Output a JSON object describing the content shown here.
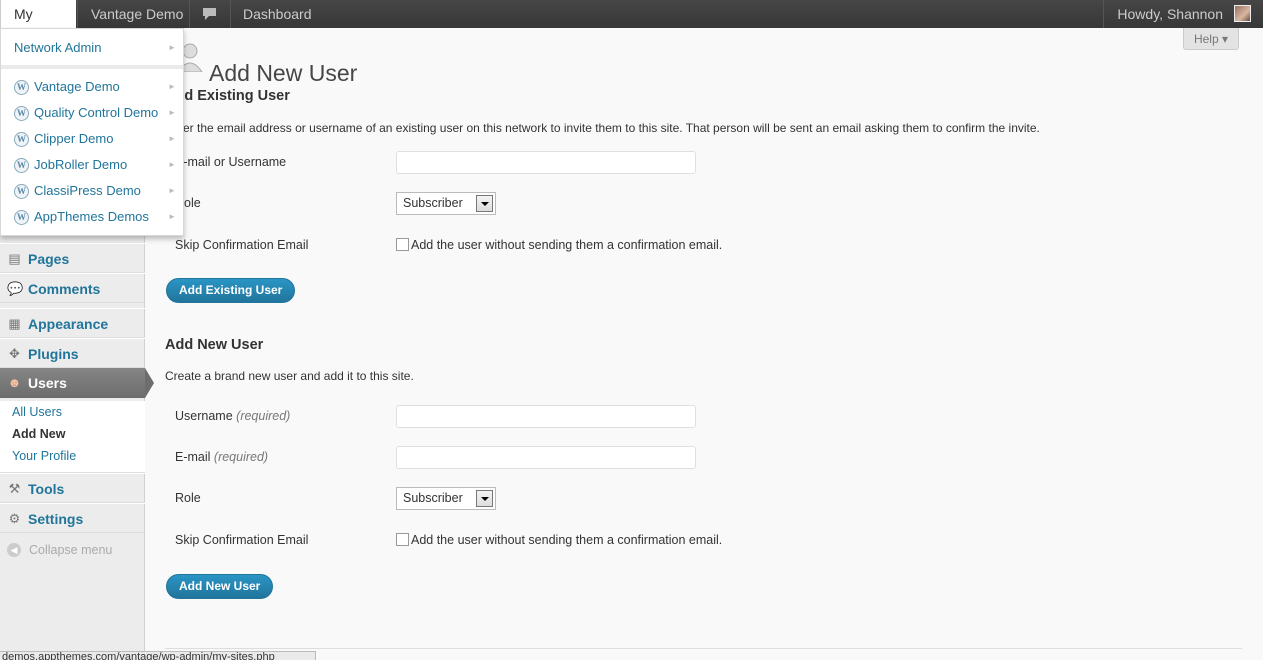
{
  "adminbar": {
    "my_sites": "My Sites",
    "site_name": "Vantage Demo",
    "dashboard": "Dashboard",
    "howdy": "Howdy, Shannon"
  },
  "help": "Help",
  "mysites_menu": {
    "network_admin": "Network Admin",
    "sites": [
      "Vantage Demo",
      "Quality Control Demo",
      "Clipper Demo",
      "JobRoller Demo",
      "ClassiPress Demo",
      "AppThemes Demos"
    ]
  },
  "menu": {
    "pages": "Pages",
    "comments": "Comments",
    "appearance": "Appearance",
    "plugins": "Plugins",
    "users": "Users",
    "users_sub": [
      "All Users",
      "Add New",
      "Your Profile"
    ],
    "tools": "Tools",
    "settings": "Settings",
    "collapse": "Collapse menu"
  },
  "page": {
    "title": "Add New User",
    "existing": {
      "heading": "Add Existing User",
      "description": "Enter the email address or username of an existing user on this network to invite them to this site. That person will be sent an email asking them to confirm the invite.",
      "email_label": "E-mail or Username",
      "role_label": "Role",
      "role_value": "Subscriber",
      "skip_label": "Skip Confirmation Email",
      "skip_text": "Add the user without sending them a confirmation email.",
      "button": "Add Existing User"
    },
    "new": {
      "heading": "Add New User",
      "description": "Create a brand new user and add it to this site.",
      "username_label": "Username",
      "email_label": "E-mail",
      "required": "(required)",
      "role_label": "Role",
      "role_value": "Subscriber",
      "skip_label": "Skip Confirmation Email",
      "skip_text": "Add the user without sending them a confirmation email.",
      "button": "Add New User"
    }
  },
  "status_url": "demos.appthemes.com/vantage/wp-admin/my-sites.php"
}
